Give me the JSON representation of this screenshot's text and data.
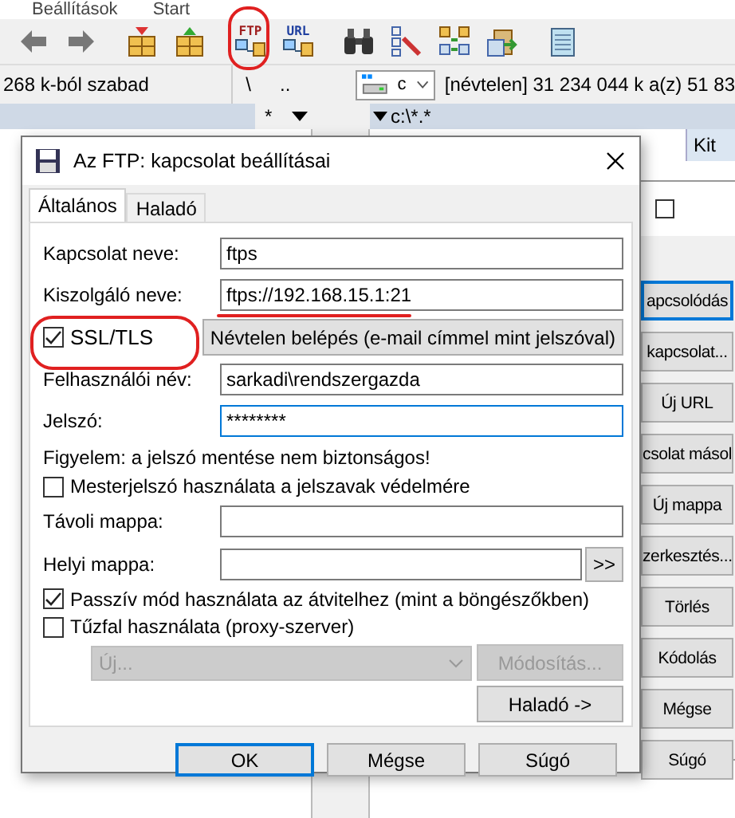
{
  "menu_bar": {
    "items": [
      {
        "label": "Beállítások"
      },
      {
        "label": "Start"
      }
    ]
  },
  "toolbar": {
    "buttons": [
      {
        "kind": "back"
      },
      {
        "kind": "forward"
      },
      {
        "kind": "pack"
      },
      {
        "kind": "unpack"
      },
      {
        "kind": "ftp",
        "label": "FTP",
        "annotated": true
      },
      {
        "kind": "url",
        "label": "URL"
      },
      {
        "kind": "find"
      },
      {
        "kind": "rename"
      },
      {
        "kind": "sync"
      },
      {
        "kind": "plugin"
      },
      {
        "kind": "notepad"
      }
    ]
  },
  "left_panel": {
    "free_space": "268 k-ból szabad",
    "filter": "*"
  },
  "nav": {
    "root": "\\",
    "up": ".."
  },
  "right_panel": {
    "drive": "c",
    "info": "[névtelen]  31 234 044 k a(z) 51 83",
    "path": "c:\\*.*",
    "tab": "Kit"
  },
  "connect_window": {
    "buttons": [
      {
        "label": "apcsolódás",
        "default": true
      },
      {
        "label": "kapcsolat...",
        "default": false
      },
      {
        "label": "Új URL",
        "default": false
      },
      {
        "label": "csolat másol",
        "default": false
      },
      {
        "label": "Új mappa",
        "default": false
      },
      {
        "label": "zerkesztés...",
        "default": false
      },
      {
        "label": "Törlés",
        "default": false
      },
      {
        "label": "Kódolás",
        "default": false
      },
      {
        "label": "Mégse",
        "default": false
      },
      {
        "label": "Súgó",
        "default": false
      }
    ]
  },
  "dialog": {
    "title": "Az FTP: kapcsolat beállításai",
    "tabs": [
      {
        "label": "Általános",
        "selected": true
      },
      {
        "label": "Haladó",
        "selected": false
      }
    ],
    "rows": [
      {
        "kind": "text",
        "label": "Kapcsolat neve:",
        "value": "ftps",
        "focused": false
      },
      {
        "kind": "text",
        "label": "Kiszolgáló neve:",
        "value": "ftps://192.168.15.1:21",
        "focused": false,
        "annotated": true
      },
      {
        "kind": "check-button",
        "label": "SSL/TLS",
        "checked": true,
        "annotated": true,
        "button": "Névtelen belépés (e-mail címmel mint jelszóval)"
      },
      {
        "kind": "text",
        "label": "Felhasználói név:",
        "value": "sarkadi\\rendszergazda",
        "focused": false
      },
      {
        "kind": "text",
        "label": "Jelszó:",
        "value": "********",
        "focused": true
      },
      {
        "kind": "note",
        "text": "Figyelem: a jelszó mentése nem biztonságos!"
      },
      {
        "kind": "check",
        "label": "Mesterjelszó használata a jelszavak védelmére",
        "checked": false
      },
      {
        "kind": "text",
        "label": "Távoli mappa:",
        "focused": false
      },
      {
        "kind": "browse",
        "label": "Helyi mappa:",
        "button": ">>"
      },
      {
        "kind": "check",
        "label": "Passzív mód használata az átvitelhez (mint a böngészőkben)",
        "checked": true
      },
      {
        "kind": "check",
        "label": "Tűzfal használata (proxy-szerver)",
        "checked": false
      },
      {
        "kind": "proxy",
        "combo": "Új...",
        "button": "Módosítás...",
        "disabled": true
      },
      {
        "kind": "right-button",
        "button": "Haladó ->"
      }
    ],
    "buttons": [
      {
        "label": "OK",
        "default": true
      },
      {
        "label": "Mégse",
        "default": false
      },
      {
        "label": "Súgó",
        "default": false
      }
    ]
  }
}
